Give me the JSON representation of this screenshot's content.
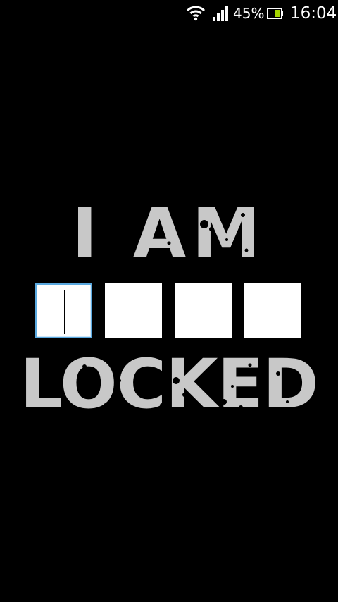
{
  "status_bar": {
    "battery_percent": "45%",
    "time": "16:04",
    "icons": [
      "wifi-icon",
      "signal-icon",
      "battery-charging-icon"
    ]
  },
  "lock_screen": {
    "title_top": "I AM",
    "title_bottom": "LOCKED",
    "pin_box_count": 4,
    "focused_box_index": 0
  },
  "colors": {
    "background": "#000000",
    "title_text": "#c8c8c8",
    "pin_box": "#ffffff",
    "focus_border": "#5aa9e0",
    "battery_fill": "#a6d600"
  }
}
